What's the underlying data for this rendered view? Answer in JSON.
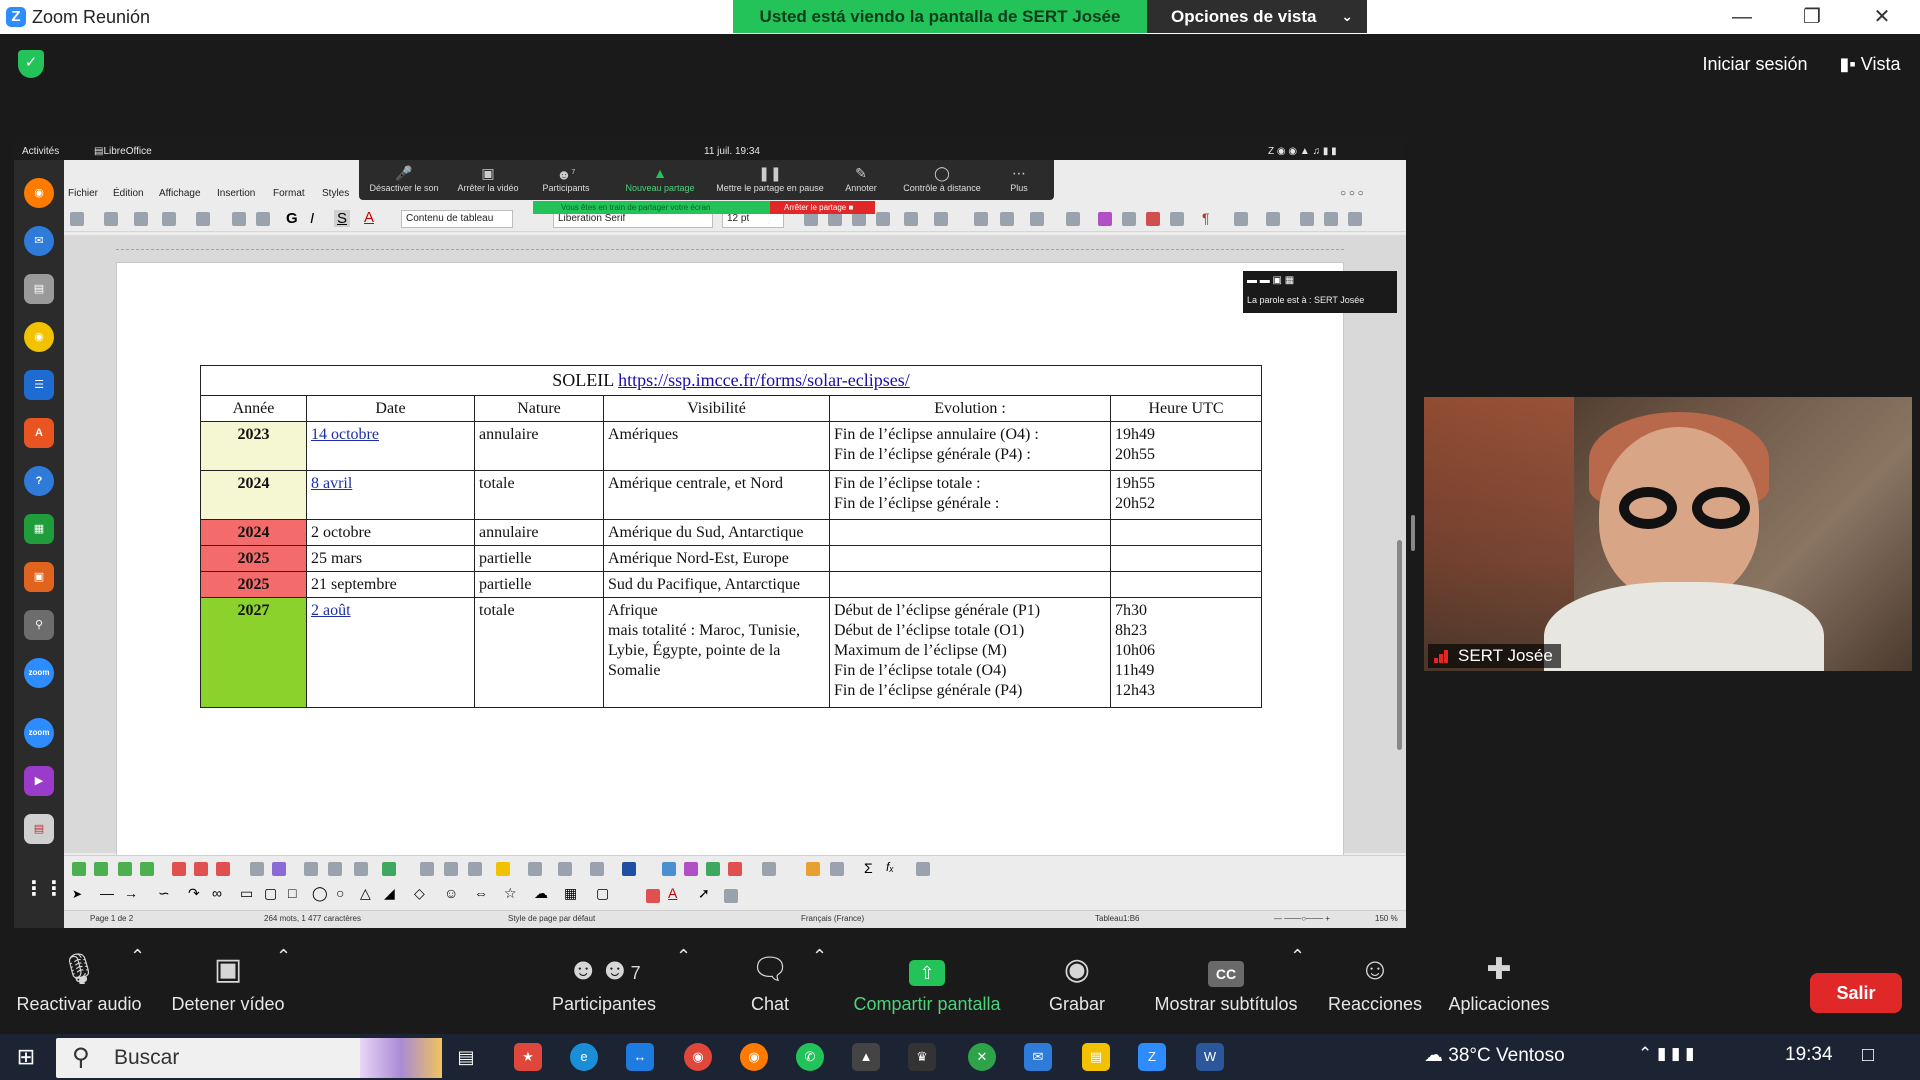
{
  "zoom": {
    "window_title": "Zoom Reunión",
    "viewing_banner": "Usted está viendo la pantalla de SERT Josée",
    "view_options": "Opciones de vista",
    "signin": "Iniciar sesión",
    "view": "Vista",
    "controls": {
      "audio": "Reactivar audio",
      "video": "Detener vídeo",
      "participants": "Participantes",
      "participants_count": "7",
      "chat": "Chat",
      "share": "Compartir pantalla",
      "record": "Grabar",
      "captions": "Mostrar subtítulos",
      "reactions": "Reacciones",
      "apps": "Aplicaciones",
      "leave": "Salir"
    },
    "participant_name": "SERT Josée",
    "accent_green": "#23c35a",
    "leave_red": "#e02828"
  },
  "ubuntu": {
    "activities": "Activités",
    "app_name": "LibreOffice Writer",
    "clock": "11 juil.  19:34"
  },
  "share_bar": {
    "mute": "Désactiver le son",
    "stop_video": "Arrêter la vidéo",
    "participants": "Participants",
    "participants_count": "7",
    "new_share": "Nouveau partage",
    "pause_share": "Mettre le partage en pause",
    "annotate": "Annoter",
    "remote_control": "Contrôle à distance",
    "more": "Plus",
    "sharing_status": "Vous êtes en train de partager votre écran",
    "stop_share": "Arrêter le partage",
    "speaker": "La parole est à : SERT Josée"
  },
  "writer": {
    "menu": [
      "Fichier",
      "Édition",
      "Affichage",
      "Insertion",
      "Format",
      "Styles"
    ],
    "paragraph_style": "Contenu de tableau",
    "font_name": "Liberation Serif",
    "font_size": "12 pt",
    "status": {
      "page": "Page 1 de 2",
      "words": "264 mots, 1 477 caractères",
      "page_style": "Style de page par défaut",
      "language": "Français (France)",
      "cell": "Tableau1:B6",
      "zoom": "150 %"
    }
  },
  "table": {
    "title_prefix": "SOLEIL ",
    "title_link": "https://ssp.imcce.fr/forms/solar-eclipses/",
    "headers": [
      "Année",
      "Date",
      "Nature",
      "Visibilité",
      "Evolution :",
      "Heure UTC"
    ],
    "rows": [
      {
        "year": "2023",
        "date": "14 octobre",
        "nature": "annulaire",
        "visibility": [
          "Amériques"
        ],
        "evolution": [
          "Fin de l’éclipse annulaire (O4) :",
          "Fin de l’éclipse générale (P4) :"
        ],
        "utc": [
          "19h49",
          "20h55"
        ]
      },
      {
        "year": "2024",
        "date": "8 avril",
        "nature": "totale",
        "visibility": [
          "Amérique centrale, et Nord"
        ],
        "evolution": [
          "Fin de l’éclipse totale :",
          "Fin de l’éclipse générale :"
        ],
        "utc": [
          "19h55",
          "20h52"
        ]
      },
      {
        "year": "2024",
        "date": "2 octobre",
        "nature": "annulaire",
        "visibility": [
          "Amérique du Sud, Antarctique"
        ],
        "evolution": [],
        "utc": []
      },
      {
        "year": "2025",
        "date": "25 mars",
        "nature": "partielle",
        "visibility": [
          "Amérique Nord-Est, Europe"
        ],
        "evolution": [],
        "utc": []
      },
      {
        "year": "2025",
        "date": "21 septembre",
        "nature": "partielle",
        "visibility": [
          "Sud du Pacifique, Antarctique"
        ],
        "evolution": [],
        "utc": []
      },
      {
        "year": "2027",
        "date": "2 août",
        "nature": "totale",
        "visibility": [
          "Afrique",
          "mais totalité : Maroc, Tunisie,",
          "Lybie, Égypte, pointe de la",
          "Somalie"
        ],
        "evolution": [
          "Début de l’éclipse générale (P1)",
          "Début de l’éclipse totale (O1)",
          "Maximum de l’éclipse (M)",
          "Fin de l’éclipse totale (O4)",
          "Fin de l’éclipse générale (P4)"
        ],
        "utc": [
          "7h30",
          "8h23",
          "10h06",
          "11h49",
          "12h43"
        ]
      }
    ],
    "year_colors": [
      "#f5f7d2",
      "#f5f7d2",
      "#f36b6b",
      "#f36b6b",
      "#f36b6b",
      "#8bd32c"
    ]
  },
  "taskbar": {
    "search": "Buscar",
    "weather": "38°C  Ventoso",
    "time": "19:34"
  }
}
